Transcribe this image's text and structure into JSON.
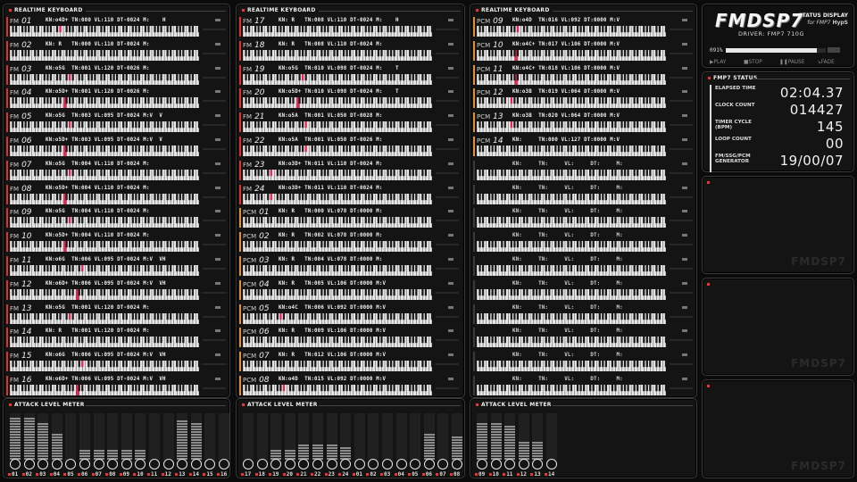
{
  "app": {
    "logo": "FMDSP7",
    "subtitle": "STATUS DISPLAY",
    "subtitle2": "for FMP7",
    "brand": "HypS",
    "driver": "DRIVER: FMP7  710G",
    "progress_pct": "091%",
    "progress_value": 0.91,
    "controls": [
      "▶PLAY",
      "■STOP",
      "❚❚PAUSE",
      "↘FADE"
    ],
    "watermark": "FMDSP7"
  },
  "panel_titles": {
    "keyboard": "REALTIME KEYBOARD",
    "meter": "ATTACK LEVEL METER",
    "status": "FMP7 STATUS"
  },
  "status": {
    "rows": [
      {
        "label": "ELAPSED TIME",
        "value": "02:04.37"
      },
      {
        "label": "CLOCK COUNT",
        "value": "014427"
      },
      {
        "label": "TIMER CYCLE (BPM)",
        "value": "145"
      },
      {
        "label": "LOOP COUNT",
        "value": "00"
      },
      {
        "label": "FM/SSG/PCM GENERATOR",
        "value": "19/00/07"
      }
    ]
  },
  "columns": [
    {
      "channels": [
        {
          "type": "FM",
          "num": "01",
          "info": "KN:o4D+ TN:000 VL:110 DT-0024 M:    H",
          "color": "#e03030",
          "keys": [
            27
          ]
        },
        {
          "type": "FM",
          "num": "02",
          "info": "KN: R   TN:000 VL:110 DT-0024 M:",
          "color": "#e03030",
          "keys": []
        },
        {
          "type": "FM",
          "num": "03",
          "info": "KN:o5G  TN:001 VL:120 DT-0026 M:",
          "color": "#e03030",
          "keys": [
            32
          ]
        },
        {
          "type": "FM",
          "num": "04",
          "info": "KN:o5D+ TN:001 VL:120 DT-0026 M:",
          "color": "#e03030",
          "keys": [
            29
          ]
        },
        {
          "type": "FM",
          "num": "05",
          "info": "KN:o5G  TN:003 VL:095 DT-0024 M:V  V",
          "color": "#e03030",
          "keys": [
            32
          ]
        },
        {
          "type": "FM",
          "num": "06",
          "info": "KN:o5D+ TN:003 VL:095 DT-0024 M:V  V",
          "color": "#e03030",
          "keys": [
            29
          ]
        },
        {
          "type": "FM",
          "num": "07",
          "info": "KN:o5G  TN:004 VL:110 DT-0024 M:",
          "color": "#e03030",
          "keys": [
            32
          ]
        },
        {
          "type": "FM",
          "num": "08",
          "info": "KN:o5D+ TN:004 VL:110 DT-0024 M:",
          "color": "#e03030",
          "keys": [
            29
          ]
        },
        {
          "type": "FM",
          "num": "09",
          "info": "KN:o5G  TN:004 VL:110 DT-0024 M:",
          "color": "#e03030",
          "keys": [
            32
          ]
        },
        {
          "type": "FM",
          "num": "10",
          "info": "KN:o5D+ TN:004 VL:110 DT-0024 M:",
          "color": "#e03030",
          "keys": [
            29
          ]
        },
        {
          "type": "FM",
          "num": "11",
          "info": "KN:o6G  TN:006 VL:095 DT-0024 M:V  VH",
          "color": "#e03030",
          "keys": [
            39
          ]
        },
        {
          "type": "FM",
          "num": "12",
          "info": "KN:o6D+ TN:006 VL:095 DT-0024 M:V  VH",
          "color": "#e03030",
          "keys": [
            36
          ]
        },
        {
          "type": "FM",
          "num": "13",
          "info": "KN:o5G  TN:001 VL:120 DT-0024 M:",
          "color": "#e03030",
          "keys": [
            32
          ]
        },
        {
          "type": "FM",
          "num": "14",
          "info": "KN: R   TN:001 VL:120 DT-0024 M:",
          "color": "#e03030",
          "keys": []
        },
        {
          "type": "FM",
          "num": "15",
          "info": "KN:o6G  TN:006 VL:095 DT-0024 M:V  VH",
          "color": "#e03030",
          "keys": [
            39
          ]
        },
        {
          "type": "FM",
          "num": "16",
          "info": "KN:o6D+ TN:006 VL:095 DT-0024 M:V  VH",
          "color": "#e03030",
          "keys": [
            36
          ]
        }
      ]
    },
    {
      "channels": [
        {
          "type": "FM",
          "num": "17",
          "info": "KN: R   TN:008 VL:110 DT-0024 M:    H",
          "color": "#e03030",
          "keys": []
        },
        {
          "type": "FM",
          "num": "18",
          "info": "KN: R   TN:008 VL:110 DT-0024 M:",
          "color": "#e03030",
          "keys": []
        },
        {
          "type": "FM",
          "num": "19",
          "info": "KN:o5G  TN:010 VL:098 DT-0024 M:    T",
          "color": "#e03030",
          "keys": [
            32
          ]
        },
        {
          "type": "FM",
          "num": "20",
          "info": "KN:o5D+ TN:010 VL:098 DT-0024 M:    T",
          "color": "#e03030",
          "keys": [
            29
          ]
        },
        {
          "type": "FM",
          "num": "21",
          "info": "KN:o5A  TN:001 VL:050 DT-0028 M:",
          "color": "#e03030",
          "keys": [
            34
          ]
        },
        {
          "type": "FM",
          "num": "22",
          "info": "KN:o5A  TN:001 VL:050 DT-0026 M:",
          "color": "#e03030",
          "keys": [
            34
          ]
        },
        {
          "type": "FM",
          "num": "23",
          "info": "KN:o3D+ TN:011 VL:110 DT-0024 M:",
          "color": "#e03030",
          "keys": [
            15
          ]
        },
        {
          "type": "FM",
          "num": "24",
          "info": "KN:o3D+ TN:011 VL:110 DT-0024 M:",
          "color": "#e03030",
          "keys": [
            15
          ]
        },
        {
          "type": "PCM",
          "num": "01",
          "info": "KN: R   TN:000 VL:078 DT:0000 M:",
          "color": "#e0903a",
          "keys": []
        },
        {
          "type": "PCM",
          "num": "02",
          "info": "KN: R   TN:002 VL:078 DT:0000 M:",
          "color": "#e0903a",
          "keys": []
        },
        {
          "type": "PCM",
          "num": "03",
          "info": "KN: R   TN:004 VL:078 DT:0000 M:",
          "color": "#e0903a",
          "keys": []
        },
        {
          "type": "PCM",
          "num": "04",
          "info": "KN: R   TN:005 VL:106 DT:0000 M:V",
          "color": "#e0903a",
          "keys": []
        },
        {
          "type": "PCM",
          "num": "05",
          "info": "KN:o4C  TN:006 VL:092 DT:0000 M:V",
          "color": "#e0903a",
          "keys": [
            20
          ]
        },
        {
          "type": "PCM",
          "num": "06",
          "info": "KN: R   TN:009 VL:106 DT:0000 M:V",
          "color": "#e0903a",
          "keys": []
        },
        {
          "type": "PCM",
          "num": "07",
          "info": "KN: R   TN:012 VL:106 DT:0000 M:V",
          "color": "#e0903a",
          "keys": []
        },
        {
          "type": "PCM",
          "num": "08",
          "info": "KN:o4D  TN:015 VL:092 DT:0000 M:V",
          "color": "#e0903a",
          "keys": [
            22
          ]
        }
      ]
    },
    {
      "channels": [
        {
          "type": "PCM",
          "num": "09",
          "info": "KN:o4D  TN:016 VL:092 DT:0000 M:V",
          "color": "#e0903a",
          "keys": [
            22
          ]
        },
        {
          "type": "PCM",
          "num": "10",
          "info": "KN:o4C+ TN:017 VL:106 DT:0000 M:V",
          "color": "#e0903a",
          "keys": [
            21
          ]
        },
        {
          "type": "PCM",
          "num": "11",
          "info": "KN:o4C+ TN:018 VL:106 DT:0000 M:V",
          "color": "#e0903a",
          "keys": [
            21
          ]
        },
        {
          "type": "PCM",
          "num": "12",
          "info": "KN:o3B  TN:019 VL:064 DT:0000 M:V",
          "color": "#e0903a",
          "keys": [
            18
          ]
        },
        {
          "type": "PCM",
          "num": "13",
          "info": "KN:o3B  TN:020 VL:064 DT:0000 M:V",
          "color": "#e0903a",
          "keys": [
            18
          ]
        },
        {
          "type": "PCM",
          "num": "14",
          "info": "KN:     TN:000 VL:127 DT:0000 M:V",
          "color": "#e0903a",
          "keys": []
        },
        {
          "type": "",
          "num": "",
          "info": "KN:     TN:     VL:     DT:     M:",
          "color": "#3a3a3a",
          "keys": []
        },
        {
          "type": "",
          "num": "",
          "info": "KN:     TN:     VL:     DT:     M:",
          "color": "#3a3a3a",
          "keys": []
        },
        {
          "type": "",
          "num": "",
          "info": "KN:     TN:     VL:     DT:     M:",
          "color": "#3a3a3a",
          "keys": []
        },
        {
          "type": "",
          "num": "",
          "info": "KN:     TN:     VL:     DT:     M:",
          "color": "#3a3a3a",
          "keys": []
        },
        {
          "type": "",
          "num": "",
          "info": "KN:     TN:     VL:     DT:     M:",
          "color": "#3a3a3a",
          "keys": []
        },
        {
          "type": "",
          "num": "",
          "info": "KN:     TN:     VL:     DT:     M:",
          "color": "#3a3a3a",
          "keys": []
        },
        {
          "type": "",
          "num": "",
          "info": "KN:     TN:     VL:     DT:     M:",
          "color": "#3a3a3a",
          "keys": []
        },
        {
          "type": "",
          "num": "",
          "info": "KN:     TN:     VL:     DT:     M:",
          "color": "#3a3a3a",
          "keys": []
        },
        {
          "type": "",
          "num": "",
          "info": "KN:     TN:     VL:     DT:     M:",
          "color": "#3a3a3a",
          "keys": []
        },
        {
          "type": "",
          "num": "",
          "info": "KN:     TN:     VL:     DT:     M:",
          "color": "#3a3a3a",
          "keys": []
        }
      ]
    }
  ],
  "meters": [
    {
      "labels": [
        "01",
        "02",
        "03",
        "04",
        "05",
        "06",
        "07",
        "08",
        "09",
        "10",
        "11",
        "12",
        "13",
        "14",
        "15",
        "16"
      ],
      "levels": [
        0.95,
        0.95,
        0.85,
        0.6,
        0,
        0.25,
        0.25,
        0.25,
        0.25,
        0.25,
        0,
        0,
        0.9,
        0.85,
        0,
        0
      ]
    },
    {
      "labels": [
        "17",
        "18",
        "19",
        "20",
        "21",
        "22",
        "23",
        "24",
        "01",
        "02",
        "03",
        "04",
        "05",
        "06",
        "07",
        "08"
      ],
      "levels": [
        0,
        0,
        0.25,
        0.25,
        0.35,
        0.35,
        0.35,
        0.3,
        0,
        0,
        0,
        0,
        0,
        0.6,
        0,
        0.55
      ]
    },
    {
      "labels": [
        "09",
        "10",
        "11",
        "12",
        "13",
        "14"
      ],
      "levels": [
        0.85,
        0.85,
        0.75,
        0.4,
        0.4,
        0
      ]
    }
  ],
  "colors": {
    "key_active": "#f02050",
    "fm": "#e03030",
    "pcm": "#e0903a"
  }
}
